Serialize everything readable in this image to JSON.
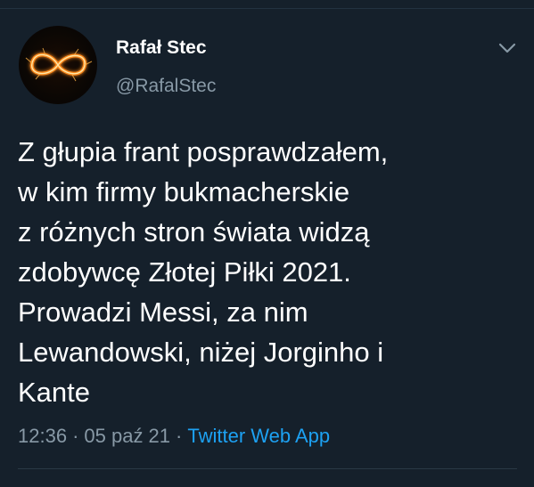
{
  "author": {
    "display_name": "Rafał Stec",
    "handle": "@RafalStec",
    "avatar_icon": "infinity-sparkler-avatar"
  },
  "tweet": {
    "lines": [
      "Z głupia frant posprawdzałem,",
      "w kim firmy bukmacherskie",
      "z różnych stron świata widzą",
      "zdobywcę Złotej Piłki 2021.",
      "Prowadzi Messi, za nim",
      "Lewandowski, niżej Jorginho i",
      "Kante"
    ]
  },
  "meta": {
    "time": "12:36",
    "separator": "·",
    "date": "05 paź 21",
    "source": "Twitter Web App"
  },
  "icons": {
    "menu": "chevron-down-icon"
  },
  "colors": {
    "background": "#15202b",
    "secondary_text": "#8899a6",
    "link": "#1da1f2"
  }
}
